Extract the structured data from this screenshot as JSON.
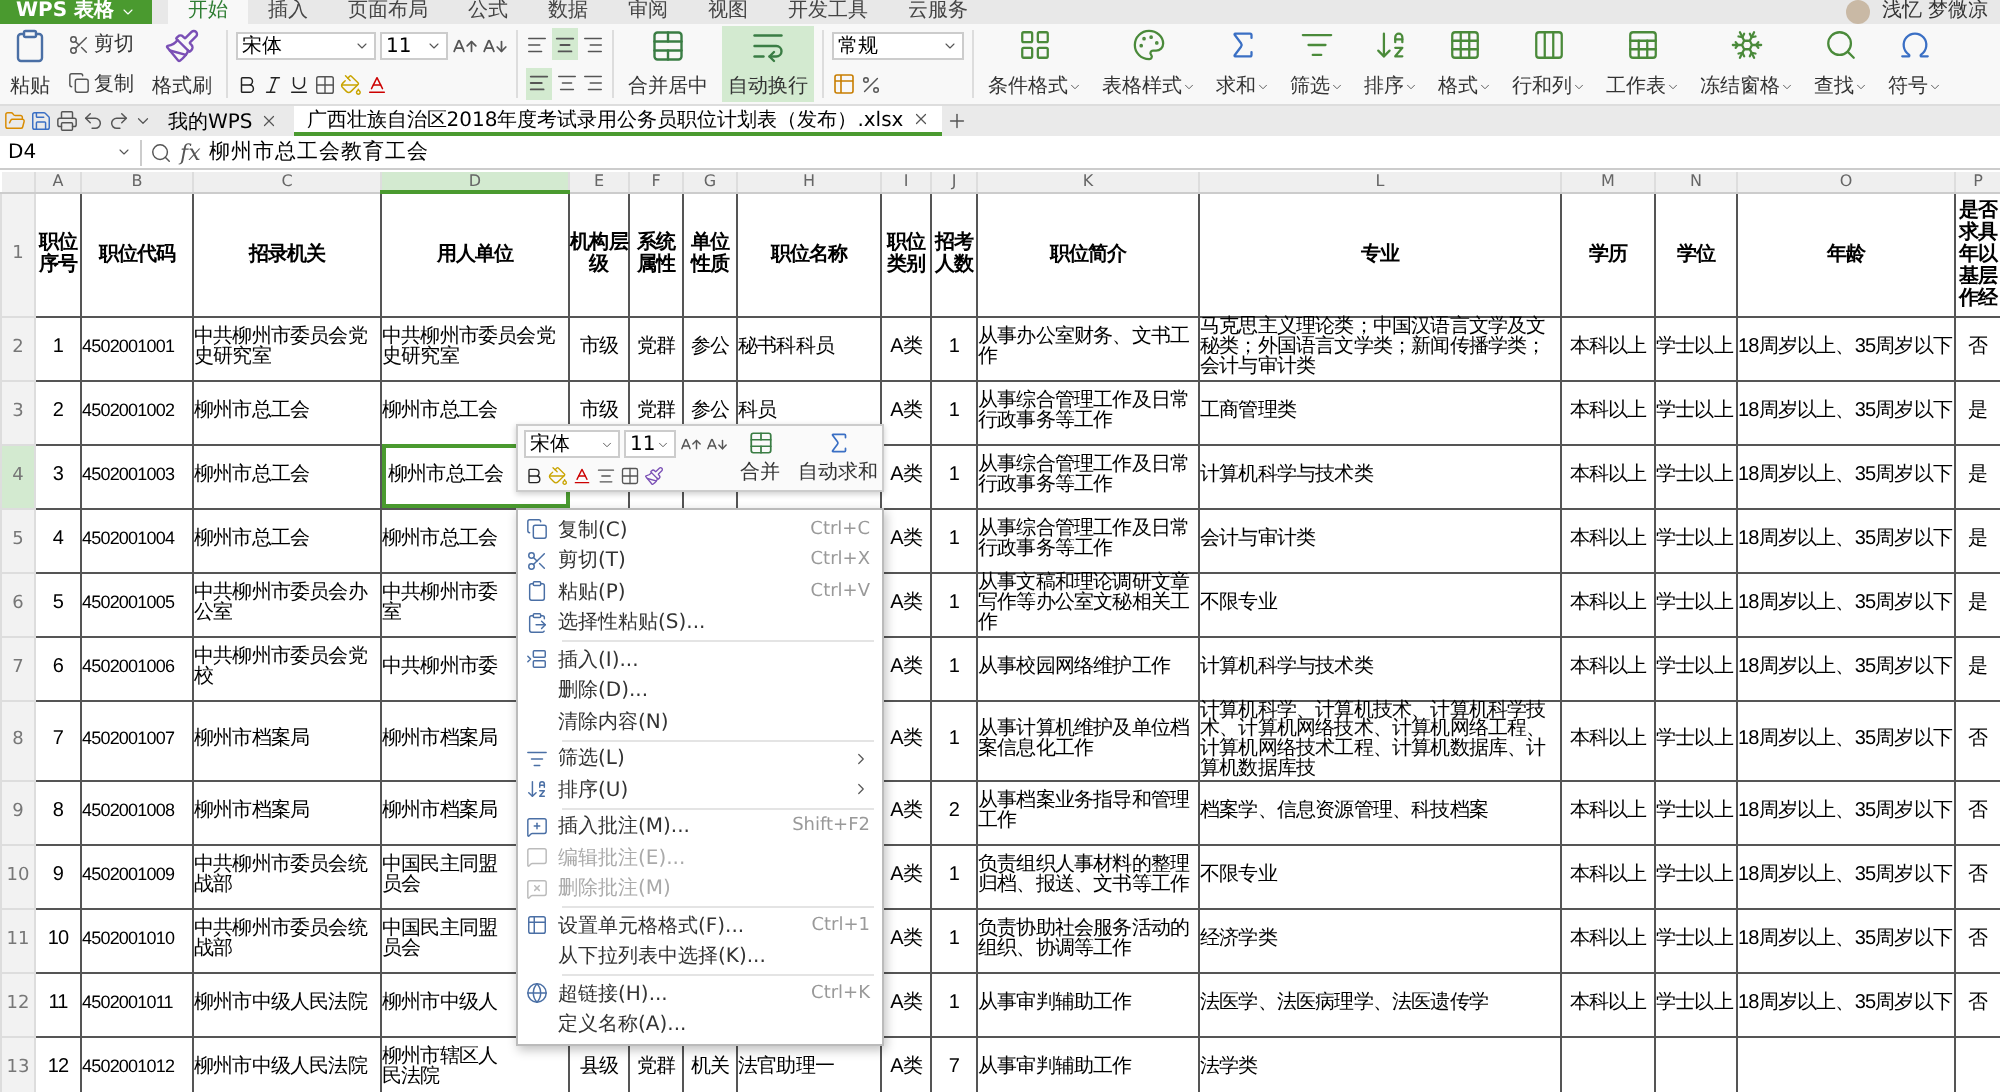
{
  "app": {
    "logo": "WPS 表格",
    "user": "浅忆 梦微凉",
    "menu_tabs": [
      {
        "label": "开始",
        "selected": true
      },
      {
        "label": "插入",
        "selected": false
      },
      {
        "label": "页面布局",
        "selected": false
      },
      {
        "label": "公式",
        "selected": false
      },
      {
        "label": "数据",
        "selected": false
      },
      {
        "label": "审阅",
        "selected": false
      },
      {
        "label": "视图",
        "selected": false
      },
      {
        "label": "开发工具",
        "selected": false
      },
      {
        "label": "云服务",
        "selected": false
      }
    ]
  },
  "ribbon": {
    "paste": "粘贴",
    "cut": "剪切",
    "copy": "复制",
    "format_painter": "格式刷",
    "font": "宋体",
    "font_size": "11",
    "wrap_buttons": [
      {
        "label": "合并居中",
        "selected": false
      },
      {
        "label": "自动换行",
        "selected": true
      }
    ],
    "number_format": "常规",
    "tools": [
      "条件格式",
      "表格样式",
      "求和",
      "筛选",
      "排序",
      "格式",
      "行和列",
      "工作表",
      "冻结窗格",
      "查找",
      "符号"
    ]
  },
  "doc_tabs": [
    {
      "label": "我的WPS",
      "selected": false
    },
    {
      "label": "广西壮族自治区2018年度考试录用公务员职位计划表（发布）.xlsx",
      "selected": true
    }
  ],
  "formula_bar": {
    "cell_ref": "D4",
    "function_label": "fx",
    "value": "柳州市总工会教育工会"
  },
  "sheet": {
    "columns": [
      {
        "letter": "A",
        "selected": false
      },
      {
        "letter": "B",
        "selected": false
      },
      {
        "letter": "C",
        "selected": false
      },
      {
        "letter": "D",
        "selected": true
      },
      {
        "letter": "E",
        "selected": false
      },
      {
        "letter": "F",
        "selected": false
      },
      {
        "letter": "G",
        "selected": false
      },
      {
        "letter": "H",
        "selected": false
      },
      {
        "letter": "I",
        "selected": false
      },
      {
        "letter": "J",
        "selected": false
      },
      {
        "letter": "K",
        "selected": false
      },
      {
        "letter": "L",
        "selected": false
      },
      {
        "letter": "M",
        "selected": false
      },
      {
        "letter": "N",
        "selected": false
      },
      {
        "letter": "O",
        "selected": false
      },
      {
        "letter": "P",
        "selected": false
      }
    ],
    "rows": [
      {
        "number": "1",
        "selected": false,
        "kind": "header",
        "cells": {
          "A": "职位序号",
          "B": "职位代码",
          "C": "招录机关",
          "D": "用人单位",
          "E": "机构层级",
          "F": "系统属性",
          "G": "单位性质",
          "H": "职位名称",
          "I": "职位类别",
          "J": "招考人数",
          "K": "职位简介",
          "L": "专业",
          "M": "学历",
          "N": "学位",
          "O": "年龄",
          "P": "是否求具年以基层作经"
        }
      },
      {
        "number": "2",
        "selected": false,
        "kind": "data",
        "cells": {
          "A": "1",
          "B": "4502001001",
          "C": "中共柳州市委员会党史研究室",
          "D": "中共柳州市委员会党史研究室",
          "E": "市级",
          "F": "党群",
          "G": "参公",
          "H": "秘书科科员",
          "I": "A类",
          "J": "1",
          "K": "从事办公室财务、文书工作",
          "L": "马克思主义理论类；中国汉语言文学及文秘类；外国语言文学类；新闻传播学类；会计与审计类",
          "M": "本科以上",
          "N": "学士以上",
          "O": "18周岁以上、35周岁以下",
          "P": "否"
        }
      },
      {
        "number": "3",
        "selected": false,
        "kind": "data",
        "cells": {
          "A": "2",
          "B": "4502001002",
          "C": "柳州市总工会",
          "D": "柳州市总工会",
          "E": "市级",
          "F": "党群",
          "G": "参公",
          "H": "科员",
          "I": "A类",
          "J": "1",
          "K": "从事综合管理工作及日常行政事务等工作",
          "L": "工商管理类",
          "M": "本科以上",
          "N": "学士以上",
          "O": "18周岁以上、35周岁以下",
          "P": "是"
        }
      },
      {
        "number": "4",
        "selected": true,
        "kind": "data",
        "cells": {
          "A": "3",
          "B": "4502001003",
          "C": "柳州市总工会",
          "D": "柳州市总工会",
          "I": "A类",
          "J": "1",
          "K": "从事综合管理工作及日常行政事务等工作",
          "L": "计算机科学与技术类",
          "M": "本科以上",
          "N": "学士以上",
          "O": "18周岁以上、35周岁以下",
          "P": "是"
        }
      },
      {
        "number": "5",
        "selected": false,
        "kind": "data",
        "cells": {
          "A": "4",
          "B": "4502001004",
          "C": "柳州市总工会",
          "D": "柳州市总工会",
          "I": "A类",
          "J": "1",
          "K": "从事综合管理工作及日常行政事务等工作",
          "L": "会计与审计类",
          "M": "本科以上",
          "N": "学士以上",
          "O": "18周岁以上、35周岁以下",
          "P": "是"
        }
      },
      {
        "number": "6",
        "selected": false,
        "kind": "data",
        "cells": {
          "A": "5",
          "B": "4502001005",
          "C": "中共柳州市委员会办公室",
          "D": "中共柳州市委室",
          "I": "A类",
          "J": "1",
          "K": "从事文稿和理论调研文章写作等办公室文秘相关工作",
          "L": "不限专业",
          "M": "本科以上",
          "N": "学士以上",
          "O": "18周岁以上、35周岁以下",
          "P": "是"
        }
      },
      {
        "number": "7",
        "selected": false,
        "kind": "data",
        "cells": {
          "A": "6",
          "B": "4502001006",
          "C": "中共柳州市委员会党校",
          "D": "中共柳州市委",
          "I": "A类",
          "J": "1",
          "K": "从事校园网络维护工作",
          "L": "计算机科学与技术类",
          "M": "本科以上",
          "N": "学士以上",
          "O": "18周岁以上、35周岁以下",
          "P": "是"
        }
      },
      {
        "number": "8",
        "selected": false,
        "kind": "data",
        "cells": {
          "A": "7",
          "B": "4502001007",
          "C": "柳州市档案局",
          "D": "柳州市档案局",
          "I": "A类",
          "J": "1",
          "K": "从事计算机维护及单位档案信息化工作",
          "L": "计算机科学、计算机技术、计算机科学技术、计算机网络技术、计算机网络工程、计算机网络技术工程、计算机数据库、计算机数据库技",
          "M": "本科以上",
          "N": "学士以上",
          "O": "18周岁以上、35周岁以下",
          "P": "否"
        }
      },
      {
        "number": "9",
        "selected": false,
        "kind": "data",
        "cells": {
          "A": "8",
          "B": "4502001008",
          "C": "柳州市档案局",
          "D": "柳州市档案局",
          "I": "A类",
          "J": "2",
          "K": "从事档案业务指导和管理工作",
          "L": "档案学、信息资源管理、科技档案",
          "M": "本科以上",
          "N": "学士以上",
          "O": "18周岁以上、35周岁以下",
          "P": "否"
        }
      },
      {
        "number": "10",
        "selected": false,
        "kind": "data",
        "cells": {
          "A": "9",
          "B": "4502001009",
          "C": "中共柳州市委员会统战部",
          "D": "中国民主同盟员会",
          "I": "A类",
          "J": "1",
          "K": "负责组织人事材料的整理归档、报送、文书等工作",
          "L": "不限专业",
          "M": "本科以上",
          "N": "学士以上",
          "O": "18周岁以上、35周岁以下",
          "P": "否"
        }
      },
      {
        "number": "11",
        "selected": false,
        "kind": "data",
        "cells": {
          "A": "10",
          "B": "4502001010",
          "C": "中共柳州市委员会统战部",
          "D": "中国民主同盟员会",
          "I": "A类",
          "J": "1",
          "K": "负责协助社会服务活动的组织、协调等工作",
          "L": "经济学类",
          "M": "本科以上",
          "N": "学士以上",
          "O": "18周岁以上、35周岁以下",
          "P": "否"
        }
      },
      {
        "number": "12",
        "selected": false,
        "kind": "data",
        "cells": {
          "A": "11",
          "B": "4502001011",
          "C": "柳州市中级人民法院",
          "D": "柳州市中级人",
          "I": "A类",
          "J": "1",
          "K": "从事审判辅助工作",
          "L": "法医学、法医病理学、法医遗传学",
          "M": "本科以上",
          "N": "学士以上",
          "O": "18周岁以上、35周岁以下",
          "P": "否"
        }
      },
      {
        "number": "13",
        "selected": false,
        "kind": "data",
        "cells": {
          "A": "12",
          "B": "4502001012",
          "C": "柳州市中级人民法院",
          "D": "柳州市辖区人民法院",
          "E": "县级",
          "F": "党群",
          "G": "机关",
          "H": "法官助理一",
          "I": "A类",
          "J": "7",
          "K": "从事审判辅助工作",
          "L": "法学类"
        }
      }
    ]
  },
  "mini_toolbar": {
    "font": "宋体",
    "font_size": "11",
    "merge": "合并",
    "autosum": "自动求和"
  },
  "context_menu": [
    {
      "kind": "item",
      "label": "复制(C)",
      "shortcut": "Ctrl+C",
      "disabled": false,
      "submenu": false
    },
    {
      "kind": "item",
      "label": "剪切(T)",
      "shortcut": "Ctrl+X",
      "disabled": false,
      "submenu": false
    },
    {
      "kind": "item",
      "label": "粘贴(P)",
      "shortcut": "Ctrl+V",
      "disabled": false,
      "submenu": false
    },
    {
      "kind": "item",
      "label": "选择性粘贴(S)...",
      "disabled": false,
      "submenu": false
    },
    {
      "kind": "separator"
    },
    {
      "kind": "item",
      "label": "插入(I)...",
      "disabled": false,
      "submenu": false
    },
    {
      "kind": "item",
      "label": "删除(D)...",
      "disabled": false,
      "submenu": false
    },
    {
      "kind": "item",
      "label": "清除内容(N)",
      "disabled": false,
      "submenu": false
    },
    {
      "kind": "separator"
    },
    {
      "kind": "item",
      "label": "筛选(L)",
      "disabled": false,
      "submenu": true
    },
    {
      "kind": "item",
      "label": "排序(U)",
      "disabled": false,
      "submenu": true
    },
    {
      "kind": "separator"
    },
    {
      "kind": "item",
      "label": "插入批注(M)...",
      "shortcut": "Shift+F2",
      "disabled": false,
      "submenu": false
    },
    {
      "kind": "item",
      "label": "编辑批注(E)...",
      "disabled": true,
      "submenu": false
    },
    {
      "kind": "item",
      "label": "删除批注(M)",
      "disabled": true,
      "submenu": false
    },
    {
      "kind": "separator"
    },
    {
      "kind": "item",
      "label": "设置单元格格式(F)...",
      "shortcut": "Ctrl+1",
      "disabled": false,
      "submenu": false
    },
    {
      "kind": "item",
      "label": "从下拉列表中选择(K)...",
      "disabled": false,
      "submenu": false
    },
    {
      "kind": "separator"
    },
    {
      "kind": "item",
      "label": "超链接(H)...",
      "shortcut": "Ctrl+K",
      "disabled": false,
      "submenu": false
    },
    {
      "kind": "item",
      "label": "定义名称(A)...",
      "disabled": false,
      "submenu": false
    }
  ]
}
